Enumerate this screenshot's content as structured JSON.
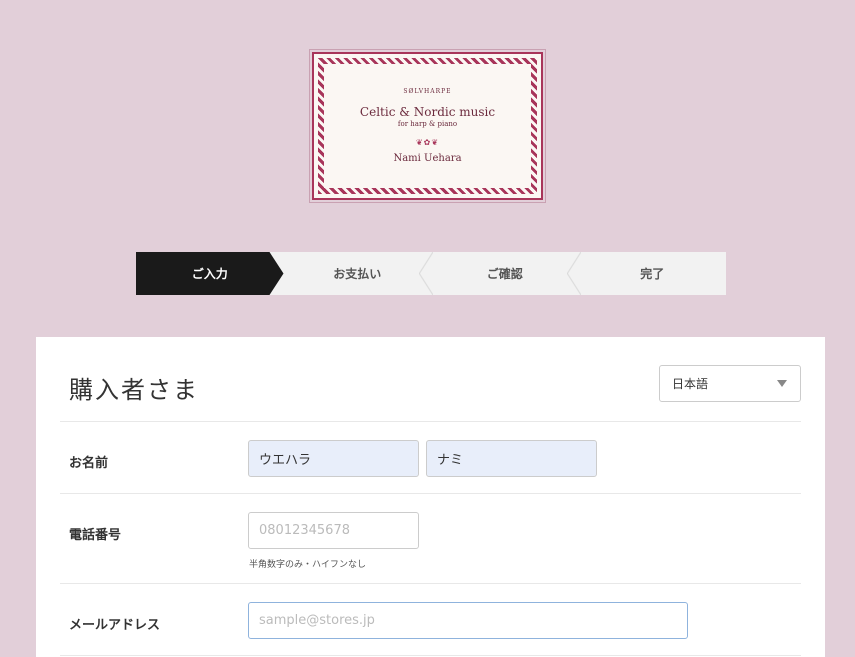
{
  "logo": {
    "brand": "SØLVHARPE",
    "title": "Celtic & Nordic music",
    "subtitle": "for harp & piano",
    "ornament": "❦✿❦",
    "artist": "Nami Uehara"
  },
  "steps": [
    {
      "label": "ご入力",
      "active": true
    },
    {
      "label": "お支払い",
      "active": false
    },
    {
      "label": "ご確認",
      "active": false
    },
    {
      "label": "完了",
      "active": false
    }
  ],
  "form": {
    "title": "購入者さま",
    "language": "日本語",
    "name_label": "お名前",
    "last_name": "ウエハラ",
    "first_name": "ナミ",
    "phone_label": "電話番号",
    "phone_placeholder": "08012345678",
    "phone_hint": "半角数字のみ・ハイフンなし",
    "email_label": "メールアドレス",
    "email_placeholder": "sample@stores.jp"
  }
}
